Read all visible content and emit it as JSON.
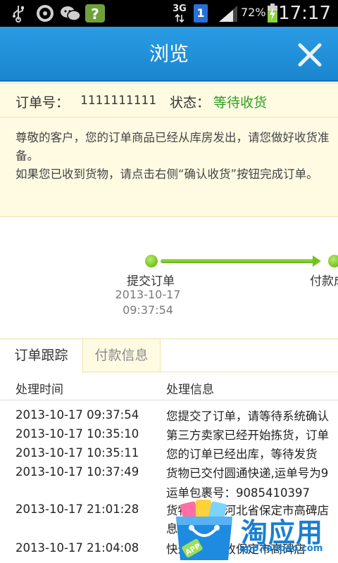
{
  "status_bar": {
    "network": "3G",
    "sim_badge": "1",
    "battery_percent": "72%",
    "time": "17:17",
    "icons": [
      "usb-icon",
      "qq-icon",
      "wechat-icon",
      "help-app-icon",
      "data-arrows-icon",
      "signal-icon",
      "battery-charging-icon"
    ]
  },
  "titlebar": {
    "title": "浏览",
    "close_icon": "close-icon"
  },
  "order": {
    "number_label": "订单号：",
    "number": "1111111111",
    "status_label": "状态：",
    "status": "等待收货",
    "status_color": "#2e9e1f",
    "message_line1": "尊敬的客户，您的订单商品已经从库房发出，请您做好收货准备。",
    "message_line2": "如果您已收到货物，请点击右侧“确认收货”按钮完成订单。"
  },
  "progress": {
    "steps": [
      {
        "label": "提交订单",
        "date": "2013-10-17",
        "time": "09:37:54"
      },
      {
        "label": "付款成",
        "date": "",
        "time": ""
      }
    ]
  },
  "tabs": {
    "items": [
      {
        "label": "订单跟踪",
        "active": true
      },
      {
        "label": "付款信息",
        "active": false
      }
    ]
  },
  "tracking": {
    "columns": [
      "处理时间",
      "处理信息"
    ],
    "rows": [
      {
        "time": "2013-10-17 09:37:54",
        "info": "您提交了订单，请等待系统确认"
      },
      {
        "time": "2013-10-17 10:35:10",
        "info": "第三方卖家已经开始拣货，订单"
      },
      {
        "time": "2013-10-17 10:35:11",
        "info": "您的订单已经出库，等待发货"
      },
      {
        "time": "2013-10-17 10:37:49",
        "info": "货物已交付圆通快递,运单号为9",
        "info2": "运单包裹号：9085410397"
      },
      {
        "time": "2013-10-17 21:01:28",
        "info": "货物已到达河北省保定市高碑店",
        "info2": "息"
      },
      {
        "time": "2013-10-17 21:04:08",
        "info": "快递员已签收保定市高碑店"
      }
    ]
  },
  "promo": {
    "title": "淘应用",
    "url": "app.taobao.com",
    "badge": "APP",
    "accent": "#1a7fd0"
  }
}
